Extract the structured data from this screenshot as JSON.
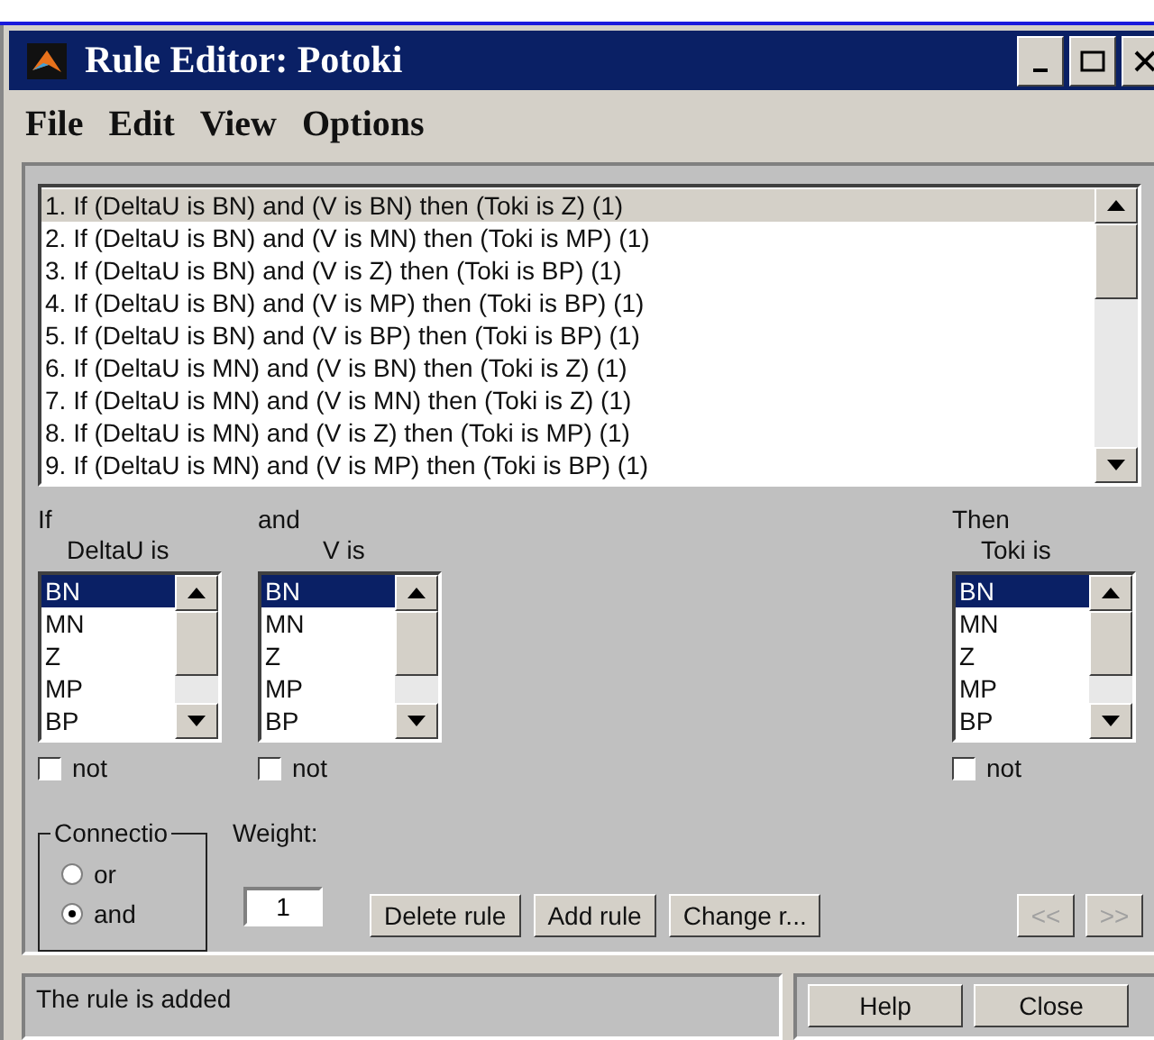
{
  "window": {
    "title": "Rule Editor: Potoki"
  },
  "menu": [
    "File",
    "Edit",
    "View",
    "Options"
  ],
  "rules": [
    {
      "text": "1. If (DeltaU is BN) and (V is BN) then (Toki is Z) (1)",
      "selected": true
    },
    {
      "text": "2. If (DeltaU is BN) and (V is MN) then (Toki is MP) (1)",
      "selected": false
    },
    {
      "text": "3. If (DeltaU is BN) and (V is Z) then (Toki is BP) (1)",
      "selected": false
    },
    {
      "text": "4. If (DeltaU is BN) and (V is MP) then (Toki is BP) (1)",
      "selected": false
    },
    {
      "text": "5. If (DeltaU is BN) and (V is BP) then (Toki is BP) (1)",
      "selected": false
    },
    {
      "text": "6. If (DeltaU is MN) and (V is BN) then (Toki is Z) (1)",
      "selected": false
    },
    {
      "text": "7. If (DeltaU is MN) and (V is MN) then (Toki is Z) (1)",
      "selected": false
    },
    {
      "text": "8. If (DeltaU is MN) and (V is Z) then (Toki is MP) (1)",
      "selected": false
    },
    {
      "text": "9. If (DeltaU is MN) and (V is MP) then (Toki is BP) (1)",
      "selected": false
    }
  ],
  "variables": [
    {
      "kind": "input",
      "connective": "If",
      "label": "DeltaU is",
      "options": [
        {
          "label": "BN",
          "selected": true
        },
        {
          "label": "MN",
          "selected": false
        },
        {
          "label": "Z",
          "selected": false
        },
        {
          "label": "MP",
          "selected": false
        },
        {
          "label": "BP",
          "selected": false
        }
      ],
      "not": {
        "label": "not",
        "checked": false
      }
    },
    {
      "kind": "input",
      "connective": "and",
      "label": "V is",
      "options": [
        {
          "label": "BN",
          "selected": true
        },
        {
          "label": "MN",
          "selected": false
        },
        {
          "label": "Z",
          "selected": false
        },
        {
          "label": "MP",
          "selected": false
        },
        {
          "label": "BP",
          "selected": false
        }
      ],
      "not": {
        "label": "not",
        "checked": false
      }
    },
    {
      "kind": "output",
      "connective": "Then",
      "label": "Toki is",
      "options": [
        {
          "label": "BN",
          "selected": true
        },
        {
          "label": "MN",
          "selected": false
        },
        {
          "label": "Z",
          "selected": false
        },
        {
          "label": "MP",
          "selected": false
        },
        {
          "label": "BP",
          "selected": false
        }
      ],
      "not": {
        "label": "not",
        "checked": false
      }
    }
  ],
  "connection": {
    "title": "Connectio",
    "options": [
      {
        "label": "or",
        "selected": false
      },
      {
        "label": "and",
        "selected": true
      }
    ]
  },
  "weight": {
    "label": "Weight:",
    "value": "1"
  },
  "rule_buttons": [
    "Delete rule",
    "Add rule",
    "Change r..."
  ],
  "nav_buttons": [
    {
      "label": "<<",
      "disabled": true
    },
    {
      "label": ">>",
      "disabled": true
    }
  ],
  "status": "The rule is added",
  "footer_buttons": [
    "Help",
    "Close"
  ]
}
